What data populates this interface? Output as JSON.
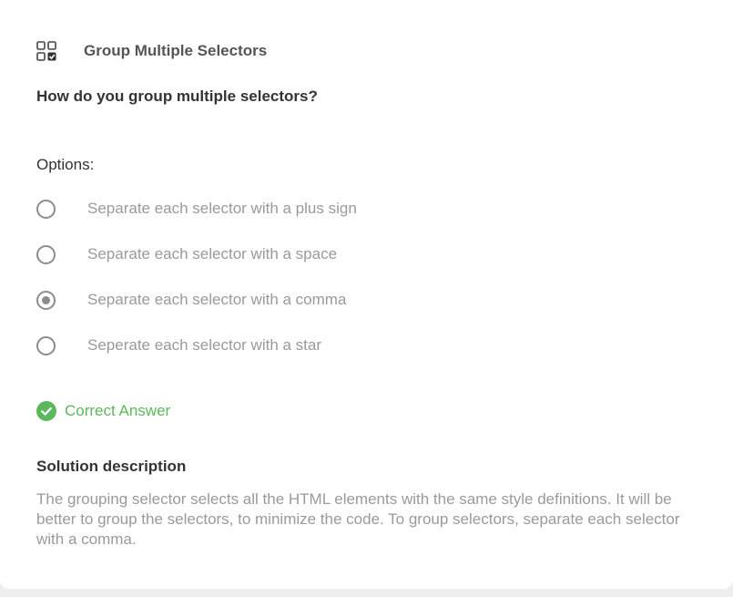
{
  "header": {
    "title": "Group Multiple Selectors",
    "icon": "grid-check-icon"
  },
  "question": "How do you group multiple selectors?",
  "options_label": "Options:",
  "options": [
    {
      "label": "Separate each selector with a plus sign",
      "selected": false
    },
    {
      "label": "Separate each selector with a space",
      "selected": false
    },
    {
      "label": "Separate each selector with a comma",
      "selected": true
    },
    {
      "label": "Seperate each selector with a star",
      "selected": false
    }
  ],
  "result": {
    "label": "Correct Answer",
    "icon": "check-circle-icon",
    "color": "#5cb85c"
  },
  "solution": {
    "title": "Solution description",
    "text": "The grouping selector selects all the HTML elements with the same style definitions. It will be better to group the selectors, to minimize the code. To group selectors, separate each selector with a comma."
  }
}
